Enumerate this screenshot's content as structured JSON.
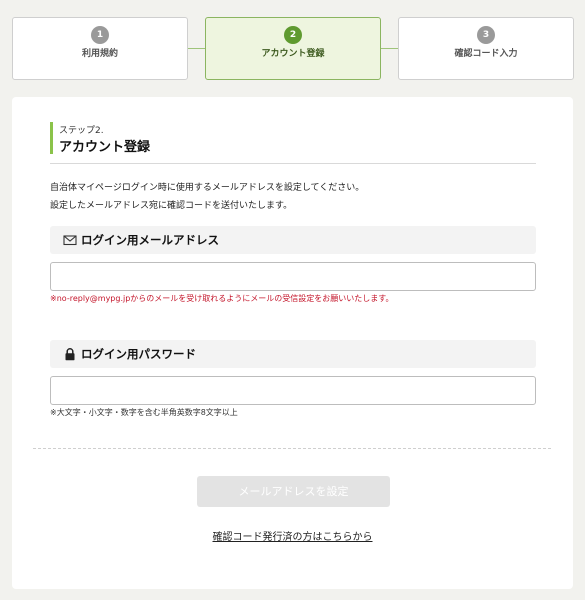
{
  "steps": [
    {
      "number": "1",
      "label": "利用規約"
    },
    {
      "number": "2",
      "label": "アカウント登録"
    },
    {
      "number": "3",
      "label": "確認コード入力"
    }
  ],
  "heading": {
    "step": "ステップ2.",
    "title": "アカウント登録"
  },
  "intro": {
    "line1": "自治体マイページログイン時に使用するメールアドレスを設定してください。",
    "line2": "設定したメールアドレス宛に確認コードを送付いたします。"
  },
  "email_field": {
    "label": "ログイン用メールアドレス",
    "icon": "mail-icon",
    "value": "",
    "note": "※no-reply@mypg.jpからのメールを受け取れるようにメールの受信設定をお願いいたします。"
  },
  "password_field": {
    "label": "ログイン用パスワード",
    "icon": "lock-icon",
    "value": "",
    "note": "※大文字・小文字・数字を含む半角英数字8文字以上"
  },
  "submit": {
    "label": "メールアドレスを設定",
    "enabled": false
  },
  "link": {
    "label": "確認コード発行済の方はこちらから"
  },
  "colors": {
    "accent": "#5f9a2f",
    "error": "#c4162b"
  }
}
